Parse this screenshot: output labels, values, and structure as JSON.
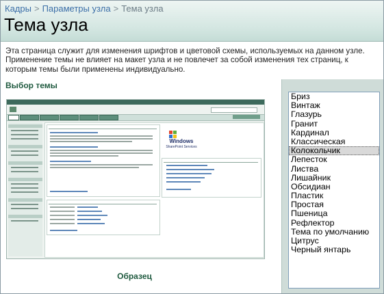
{
  "breadcrumb": {
    "items": [
      "Кадры",
      "Параметры узла",
      "Тема узла"
    ],
    "separator": ">"
  },
  "page_title": "Тема узла",
  "description": "Эта страница служит для изменения шрифтов и цветовой схемы, используемых на данном узле. Применение темы не влияет на макет узла и не повлечет за собой изменения тех страниц, к которым темы были применены индивидуально.",
  "section_title": "Выбор темы",
  "preview": {
    "caption": "Образец",
    "logo_text": "Windows",
    "logo_subtext": "SharePoint Services"
  },
  "theme_list": {
    "items": [
      "Бриз",
      "Винтаж",
      "Глазурь",
      "Гранит",
      "Кардинал",
      "Классическая",
      "Колокольчик",
      "Лепесток",
      "Листва",
      "Лишайник",
      "Обсидиан",
      "Пластик",
      "Простая",
      "Пшеница",
      "Рефлектор",
      "Тема по умолчанию",
      "Цитрус",
      "Черный янтарь"
    ],
    "selected_index": 6
  },
  "colors": {
    "header_gradient_top": "#eef5f3",
    "header_gradient_bottom": "#c4dcd6",
    "link": "#3c6fa8",
    "section_title": "#1f5a3f",
    "right_panel_bg": "#cfdcd8"
  }
}
